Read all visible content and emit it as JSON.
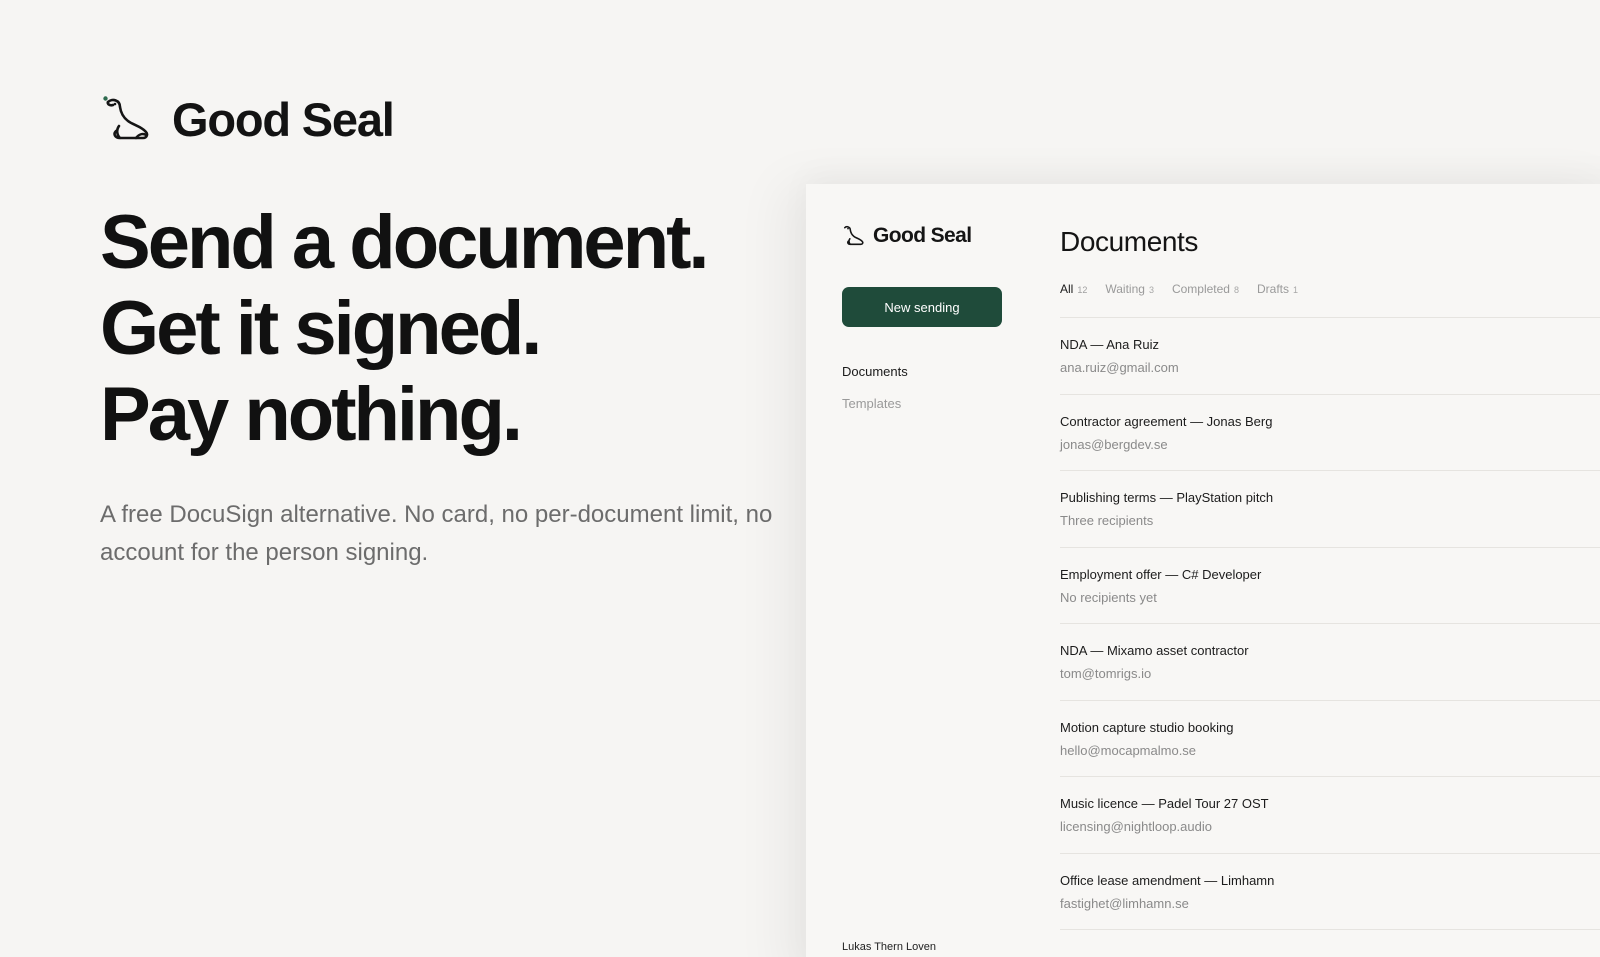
{
  "brand": {
    "name": "Good Seal",
    "logo_icon": "seal-icon",
    "accent": "#1f4b3a"
  },
  "hero": {
    "headline": [
      "Send a document.",
      "Get it signed.",
      "Pay nothing."
    ],
    "subtitle": "A free DocuSign alternative. No card, no per-document limit, no account for the person signing."
  },
  "app": {
    "brand_name": "Good Seal",
    "new_button_label": "New sending",
    "nav": [
      {
        "label": "Documents",
        "active": true
      },
      {
        "label": "Templates",
        "active": false
      }
    ],
    "user_name": "Lukas Thern Loven",
    "page_title": "Documents",
    "tabs": [
      {
        "label": "All",
        "count": "12",
        "active": true
      },
      {
        "label": "Waiting",
        "count": "3",
        "active": false
      },
      {
        "label": "Completed",
        "count": "8",
        "active": false
      },
      {
        "label": "Drafts",
        "count": "1",
        "active": false
      }
    ],
    "documents": [
      {
        "title": "NDA — Ana Ruiz",
        "recipient": "ana.ruiz@gmail.com"
      },
      {
        "title": "Contractor agreement — Jonas Berg",
        "recipient": "jonas@bergdev.se"
      },
      {
        "title": "Publishing terms — PlayStation pitch",
        "recipient": "Three recipients"
      },
      {
        "title": "Employment offer — C# Developer",
        "recipient": "No recipients yet"
      },
      {
        "title": "NDA — Mixamo asset contractor",
        "recipient": "tom@tomrigs.io"
      },
      {
        "title": "Motion capture studio booking",
        "recipient": "hello@mocapmalmo.se"
      },
      {
        "title": "Music licence — Padel Tour 27 OST",
        "recipient": "licensing@nightloop.audio"
      },
      {
        "title": "Office lease amendment — Limhamn",
        "recipient": "fastighet@limhamn.se"
      }
    ]
  }
}
